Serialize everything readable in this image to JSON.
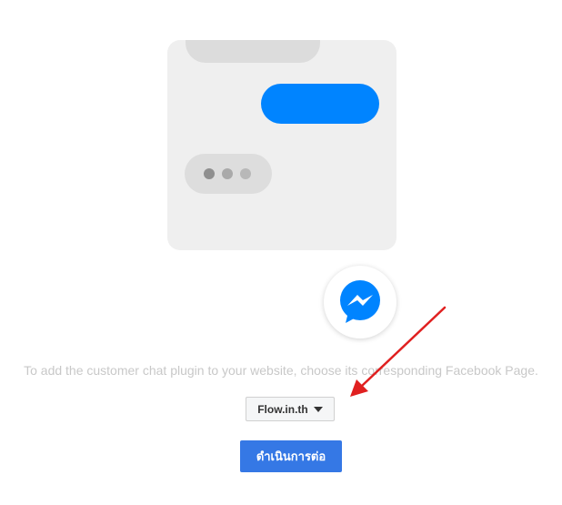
{
  "instruction": "To add the customer chat plugin to your website, choose its corresponding Facebook Page.",
  "page_select": {
    "selected_value": "Flow.in.th"
  },
  "continue_button": {
    "label": "ดำเนินการต่อ"
  },
  "icons": {
    "badge": "messenger-icon",
    "select_caret": "caret-down-icon",
    "annotation": "red-arrow-icon"
  },
  "colors": {
    "messenger_blue": "#0084ff",
    "button_blue": "#3578e5",
    "annotation_red": "#e02020"
  }
}
